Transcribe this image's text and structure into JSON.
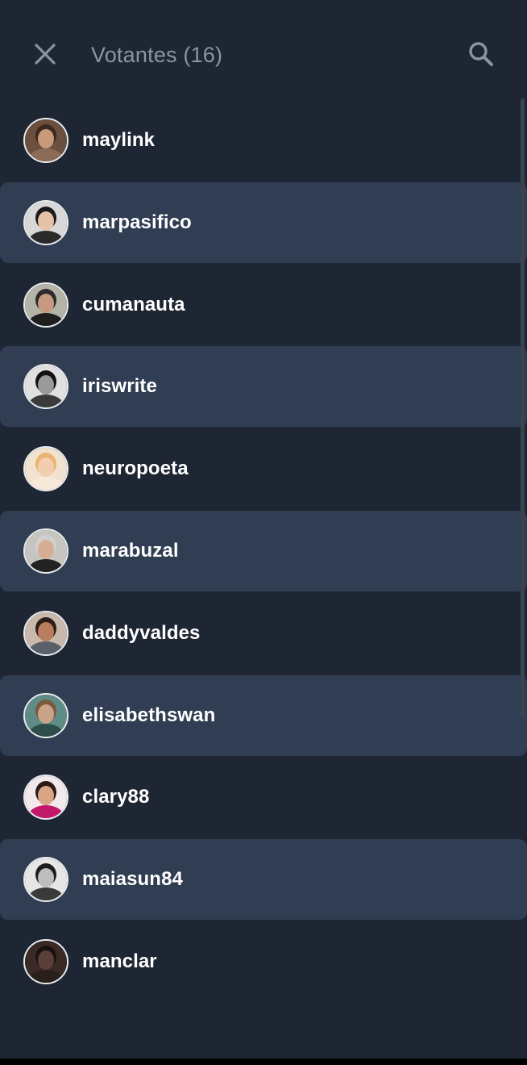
{
  "header": {
    "title": "Votantes (16)",
    "close_icon": "close-icon",
    "search_icon": "search-icon"
  },
  "colors": {
    "background": "#1f2633",
    "row_alt": "#303d52",
    "title": "#8a94a3",
    "icon": "#8a94a3"
  },
  "voters": [
    {
      "username": "maylink",
      "alt": false,
      "avatar": {
        "bg": "#6b4f3f",
        "skin": "#c99a7a",
        "hair": "#3b2a22",
        "shirt": "#8a6b55"
      }
    },
    {
      "username": "marpasifico",
      "alt": true,
      "avatar": {
        "bg": "#d8d8d8",
        "skin": "#e8c2a8",
        "hair": "#1a1a1a",
        "shirt": "#2a2a2a"
      }
    },
    {
      "username": "cumanauta",
      "alt": false,
      "avatar": {
        "bg": "#b5b2a8",
        "skin": "#c79a80",
        "hair": "#2b2b2b",
        "shirt": "#1e1e1e"
      }
    },
    {
      "username": "iriswrite",
      "alt": true,
      "avatar": {
        "bg": "#e0e0e0",
        "skin": "#9a9a9a",
        "hair": "#111111",
        "shirt": "#3a3a3a"
      }
    },
    {
      "username": "neuropoeta",
      "alt": false,
      "avatar": {
        "bg": "#f1e2cf",
        "skin": "#f3cdb0",
        "hair": "#e9b56f",
        "shirt": "#f6e9da"
      }
    },
    {
      "username": "marabuzal",
      "alt": true,
      "avatar": {
        "bg": "#c8c5c0",
        "skin": "#d7ae94",
        "hair": "#d0d0d0",
        "shirt": "#222222"
      }
    },
    {
      "username": "daddyvaldes",
      "alt": false,
      "avatar": {
        "bg": "#c9b9ad",
        "skin": "#b77f5d",
        "hair": "#2c1e16",
        "shirt": "#5a5f6a"
      }
    },
    {
      "username": "elisabethswan",
      "alt": true,
      "avatar": {
        "bg": "#5f8c86",
        "skin": "#caa48a",
        "hair": "#7a5a3e",
        "shirt": "#2f4d4a"
      }
    },
    {
      "username": "clary88",
      "alt": false,
      "avatar": {
        "bg": "#f2e9ec",
        "skin": "#d9a587",
        "hair": "#2a1a14",
        "shirt": "#c2186b"
      }
    },
    {
      "username": "maiasun84",
      "alt": true,
      "avatar": {
        "bg": "#e6e6e6",
        "skin": "#bdbdbd",
        "hair": "#1c1c1c",
        "shirt": "#3a3a3a"
      }
    },
    {
      "username": "manclar",
      "alt": false,
      "avatar": {
        "bg": "#3a2a26",
        "skin": "#5a3f38",
        "hair": "#1a1210",
        "shirt": "#2b1f1c"
      }
    }
  ]
}
